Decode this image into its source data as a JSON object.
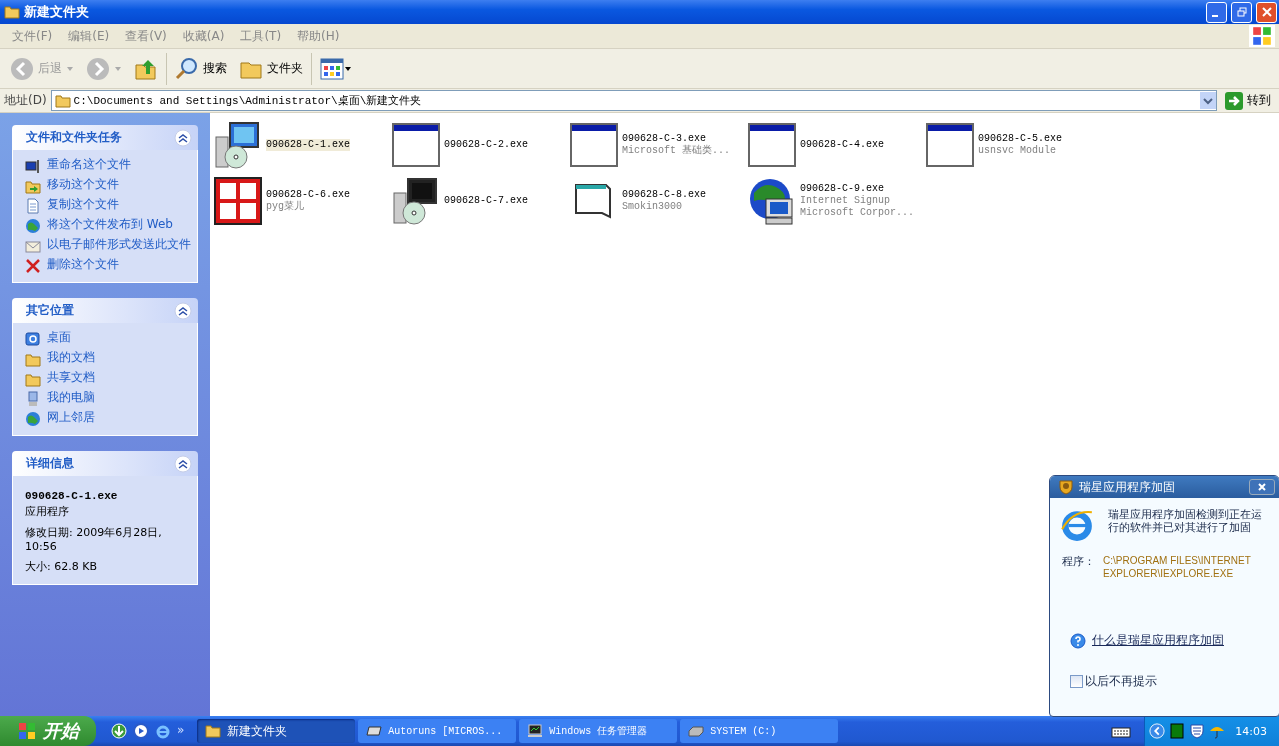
{
  "window": {
    "title": "新建文件夹"
  },
  "menu": [
    {
      "label": "文件(F)"
    },
    {
      "label": "编辑(E)"
    },
    {
      "label": "查看(V)"
    },
    {
      "label": "收藏(A)"
    },
    {
      "label": "工具(T)"
    },
    {
      "label": "帮助(H)"
    }
  ],
  "toolbar": {
    "back": "后退",
    "search": "搜索",
    "folders": "文件夹"
  },
  "address": {
    "label": "地址(D)",
    "value": "C:\\Documents and Settings\\Administrator\\桌面\\新建文件夹",
    "go": "转到"
  },
  "panels": [
    {
      "title": "文件和文件夹任务",
      "items": [
        {
          "label": "重命名这个文件",
          "kind": "rename"
        },
        {
          "label": "移动这个文件",
          "kind": "move"
        },
        {
          "label": "复制这个文件",
          "kind": "copy"
        },
        {
          "label": "将这个文件发布到 Web",
          "kind": "publish"
        },
        {
          "label": "以电子邮件形式发送此文件",
          "kind": "email"
        },
        {
          "label": "删除这个文件",
          "kind": "delete"
        }
      ]
    },
    {
      "title": "其它位置",
      "items": [
        {
          "label": "桌面",
          "kind": "desktop"
        },
        {
          "label": "我的文档",
          "kind": "documents"
        },
        {
          "label": "共享文档",
          "kind": "folder"
        },
        {
          "label": "我的电脑",
          "kind": "computer"
        },
        {
          "label": "网上邻居",
          "kind": "network"
        }
      ]
    }
  ],
  "details": {
    "title": "详细信息",
    "name": "090628-C-1.exe",
    "type": "应用程序",
    "modified": "修改日期: 2009年6月28日, 10:56",
    "size": "大小: 62.8 KB"
  },
  "files": [
    {
      "name": "090628-C-1.exe",
      "kind": "installer",
      "selected": true
    },
    {
      "name": "090628-C-2.exe",
      "kind": "window",
      "selected": false
    },
    {
      "name": "090628-C-3.exe",
      "lines": [
        "Microsoft 基础类..."
      ],
      "kind": "window",
      "selected": false
    },
    {
      "name": "090628-C-4.exe",
      "kind": "window",
      "selected": false
    },
    {
      "name": "090628-C-5.exe",
      "lines": [
        "usnsvc Module"
      ],
      "kind": "window",
      "selected": false
    },
    {
      "name": "090628-C-6.exe",
      "lines": [
        "pyg菜儿"
      ],
      "kind": "redbox",
      "selected": false
    },
    {
      "name": "090628-C-7.exe",
      "kind": "installer2",
      "selected": false
    },
    {
      "name": "090628-C-8.exe",
      "lines": [
        "Smokin3000"
      ],
      "kind": "flag",
      "selected": false
    },
    {
      "name": "090628-C-9.exe",
      "lines": [
        "Internet Signup",
        "Microsoft Corpor..."
      ],
      "kind": "globe",
      "selected": false
    }
  ],
  "popup": {
    "title": "瑞星应用程序加固",
    "message": "瑞星应用程序加固检测到正在运行的软件并已对其进行了加固",
    "program_label": "程序：",
    "program_path": "C:\\PROGRAM FILES\\INTERNET EXPLORER\\IEXPLORE.EXE",
    "link": "什么是瑞星应用程序加固",
    "checkbox": {
      "label": "以后不再提示",
      "checked": false
    }
  },
  "taskbar": {
    "start": "开始",
    "quick_launch": [
      {
        "kind": "download"
      },
      {
        "kind": "media"
      },
      {
        "kind": "browser"
      }
    ],
    "more": "»",
    "tasks": [
      {
        "label": "新建文件夹",
        "kind": "folder",
        "selected": true
      },
      {
        "label": "Autoruns [MICROS...",
        "kind": "app",
        "selected": false
      },
      {
        "label": "Windows 任务管理器",
        "kind": "monitor",
        "selected": false
      },
      {
        "label": "SYSTEM (C:)",
        "kind": "drive",
        "selected": false
      }
    ],
    "clock": "14:03"
  }
}
